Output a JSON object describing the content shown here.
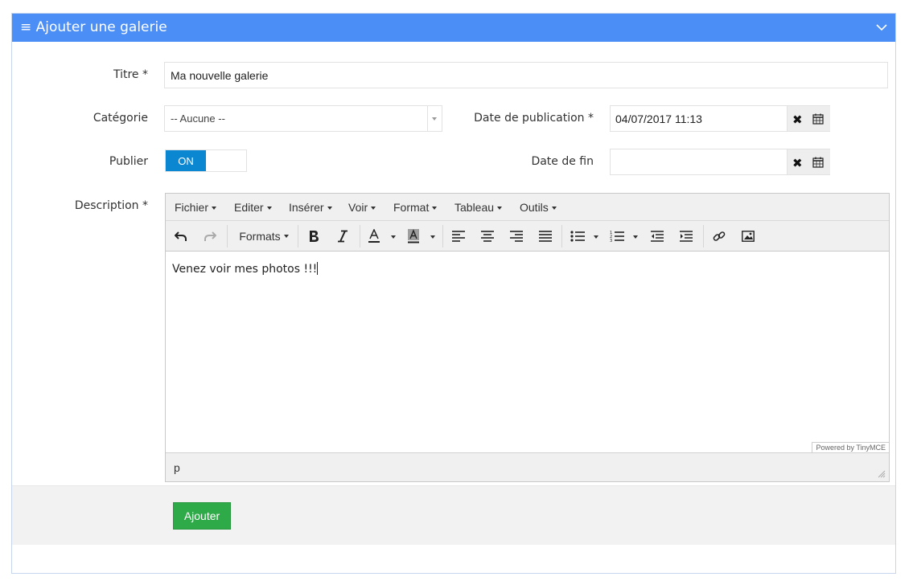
{
  "panel": {
    "title": "Ajouter une galerie",
    "menu_glyph": "≡",
    "collapse_icon": "chevron-down-icon",
    "header_color": "#4b8ef5"
  },
  "form": {
    "title_label": "Titre *",
    "title_value": "Ma nouvelle galerie",
    "category_label": "Catégorie",
    "category_value": "-- Aucune --",
    "pub_date_label": "Date de publication *",
    "pub_date_value": "04/07/2017 11:13",
    "end_date_label": "Date de fin",
    "end_date_value": "",
    "publish_label": "Publier",
    "publish_state": "ON",
    "description_label": "Description *",
    "clear_glyph": "✖"
  },
  "editor": {
    "menus": [
      "Fichier",
      "Editer",
      "Insérer",
      "Voir",
      "Format",
      "Tableau",
      "Outils"
    ],
    "formats_label": "Formats",
    "content": "Venez voir mes photos !!!",
    "powered_by": "Powered by TinyMCE",
    "path": "p"
  },
  "footer": {
    "submit_label": "Ajouter",
    "submit_color": "#2eab48"
  }
}
